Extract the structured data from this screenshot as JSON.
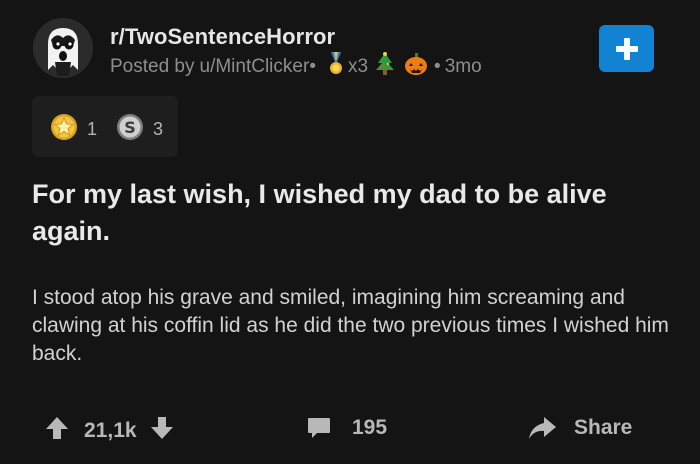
{
  "post": {
    "subreddit": "r/TwoSentenceHorror",
    "posted_by_prefix": "Posted by",
    "username": "u/MintClicker",
    "dot_sep": "•",
    "award_multiplier": "x3",
    "time_sep": "•",
    "age": "3mo",
    "title": "For my last wish, I wished my dad to be alive again.",
    "body": "I stood atop his grave and smiled, imagining him screaming and clawing at his coffin lid as he did the two previous times I wished him back."
  },
  "awards": [
    {
      "icon": "gold-star-award-icon",
      "count": "1"
    },
    {
      "icon": "silver-coin-award-icon",
      "count": "3"
    }
  ],
  "actions": {
    "votes": "21,1k",
    "comments": "195",
    "share_label": "Share"
  },
  "colors": {
    "background": "#141414",
    "join_button": "#1282d2",
    "meta_text": "#8e8e8e",
    "title_text": "#e9e9e9",
    "body_text": "#d2d2d2",
    "action_text": "#b8b8b8"
  }
}
